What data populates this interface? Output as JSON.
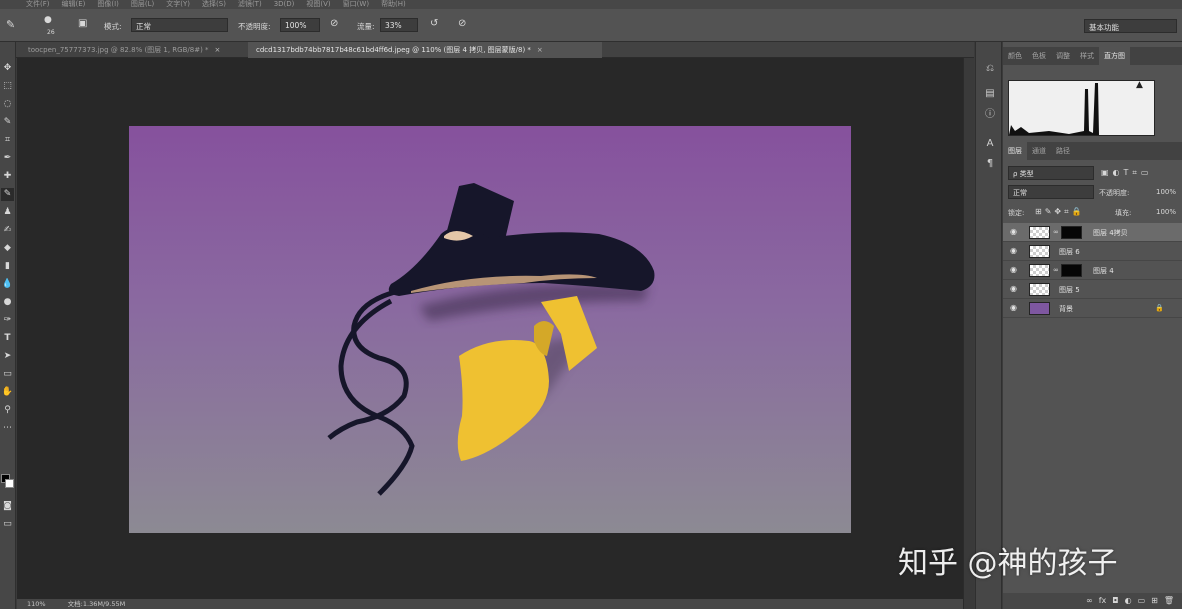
{
  "menu": [
    "文件(F)",
    "编辑(E)",
    "图像(I)",
    "图层(L)",
    "文字(Y)",
    "选择(S)",
    "滤镜(T)",
    "3D(D)",
    "视图(V)",
    "窗口(W)",
    "帮助(H)"
  ],
  "options": {
    "brush_size": "26",
    "mode_label": "模式:",
    "mode_value": "正常",
    "opacity_label": "不透明度:",
    "opacity_value": "100%",
    "flow_label": "流量:",
    "flow_value": "33%",
    "workspace": "基本功能"
  },
  "tabs": [
    {
      "label": "toocpen_75777373.jpg @ 82.8% (图层 1, RGB/8#) *",
      "active": false
    },
    {
      "label": "cdcd1317bdb74bb7817b48c61bd4ff6d.jpeg @ 110% (图层 4 拷贝, 图层蒙版/8) *",
      "active": true
    }
  ],
  "status": {
    "zoom": "110%",
    "doc": "文档:1.36M/9.55M"
  },
  "panels": {
    "top_tabs": [
      "颜色",
      "色板",
      "调整",
      "样式",
      "直方图"
    ],
    "active_top_tab": "直方图",
    "layer_tabs": [
      "图层",
      "通道",
      "路径"
    ],
    "filter_kind": "ρ 类型",
    "blend_mode": "正常",
    "opacity_label": "不透明度:",
    "opacity_value": "100%",
    "lock_label": "锁定:",
    "fill_label": "填充:",
    "fill_value": "100%"
  },
  "layers": [
    {
      "name": "图层 4拷贝",
      "selected": true,
      "thumb": "checker",
      "mask": true
    },
    {
      "name": "图层 6",
      "selected": false,
      "thumb": "checker",
      "mask": false
    },
    {
      "name": "图层 4",
      "selected": false,
      "thumb": "checker",
      "mask": true
    },
    {
      "name": "图层 5",
      "selected": false,
      "thumb": "checker",
      "mask": false
    },
    {
      "name": "背景",
      "selected": false,
      "thumb": "purple",
      "mask": false,
      "locked": true
    }
  ],
  "colors": {
    "doc_top": "#86519d",
    "doc_bottom": "#8c8a93",
    "shoe_black": "#16162a",
    "shoe_yellow": "#efc131"
  },
  "watermark": "知乎 @神的孩子"
}
